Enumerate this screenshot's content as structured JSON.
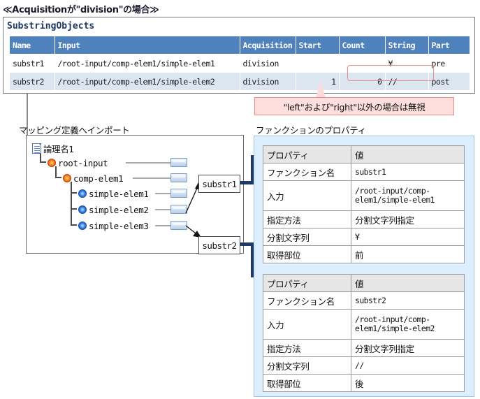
{
  "title": "≪Acquisitionが\"division\"の場合≫",
  "substring_panel": {
    "heading": "SubstringObjects",
    "columns": [
      "Name",
      "Input",
      "Acquisition",
      "Start",
      "Count",
      "String",
      "Part"
    ],
    "rows": [
      {
        "name": "substr1",
        "input": "/root-input/comp-elem1/simple-elem1",
        "acquisition": "division",
        "start": "",
        "count": "",
        "string": "¥",
        "part": "pre"
      },
      {
        "name": "substr2",
        "input": "/root-input/comp-elem1/simple-elem2",
        "acquisition": "division",
        "start": "1",
        "count": "0",
        "string": "//",
        "part": "post"
      }
    ],
    "highlight_color": "#f08a8a"
  },
  "callout": {
    "text": "\"left\"および\"right\"以外の場合は無視",
    "background": "#ffdede",
    "border": "#f08a8a"
  },
  "labels": {
    "mapping": "マッピング定義へインポート",
    "function_properties": "ファンクションのプロパティ"
  },
  "tree": {
    "nodes": [
      {
        "label": "論理名1",
        "icon": "document-icon",
        "depth": 0,
        "connector": false
      },
      {
        "label": "root-input",
        "icon": "complex-element-icon",
        "depth": 1,
        "connector": true
      },
      {
        "label": "comp-elem1",
        "icon": "complex-element-icon",
        "depth": 2,
        "connector": true
      },
      {
        "label": "simple-elem1",
        "icon": "simple-element-icon",
        "depth": 3,
        "connector": true
      },
      {
        "label": "simple-elem2",
        "icon": "simple-element-icon",
        "depth": 3,
        "connector": true
      },
      {
        "label": "simple-elem3",
        "icon": "simple-element-icon",
        "depth": 3,
        "connector": true
      }
    ]
  },
  "function_boxes": [
    {
      "label": "substr1"
    },
    {
      "label": "substr2"
    }
  ],
  "properties": [
    {
      "header": {
        "property": "プロパティ",
        "value": "値"
      },
      "rows": [
        {
          "property": "ファンクション名",
          "value": "substr1"
        },
        {
          "property": "入力",
          "value": "/root-input/comp-elem1/simple-elem1"
        },
        {
          "property": "指定方法",
          "value": "分割文字列指定"
        },
        {
          "property": "分割文字列",
          "value": "¥"
        },
        {
          "property": "取得部位",
          "value": "前"
        }
      ]
    },
    {
      "header": {
        "property": "プロパティ",
        "value": "値"
      },
      "rows": [
        {
          "property": "ファンクション名",
          "value": "substr2"
        },
        {
          "property": "入力",
          "value": "/root-input/comp-elem1/simple-elem2"
        },
        {
          "property": "指定方法",
          "value": "分割文字列指定"
        },
        {
          "property": "分割文字列",
          "value": "//"
        },
        {
          "property": "取得部位",
          "value": "後"
        }
      ]
    }
  ],
  "colors": {
    "table_header": "#4f81bd",
    "table_row_alt": "#dce6f1",
    "panel_background": "#ddeeff",
    "connector_navy": "#1f3864"
  }
}
